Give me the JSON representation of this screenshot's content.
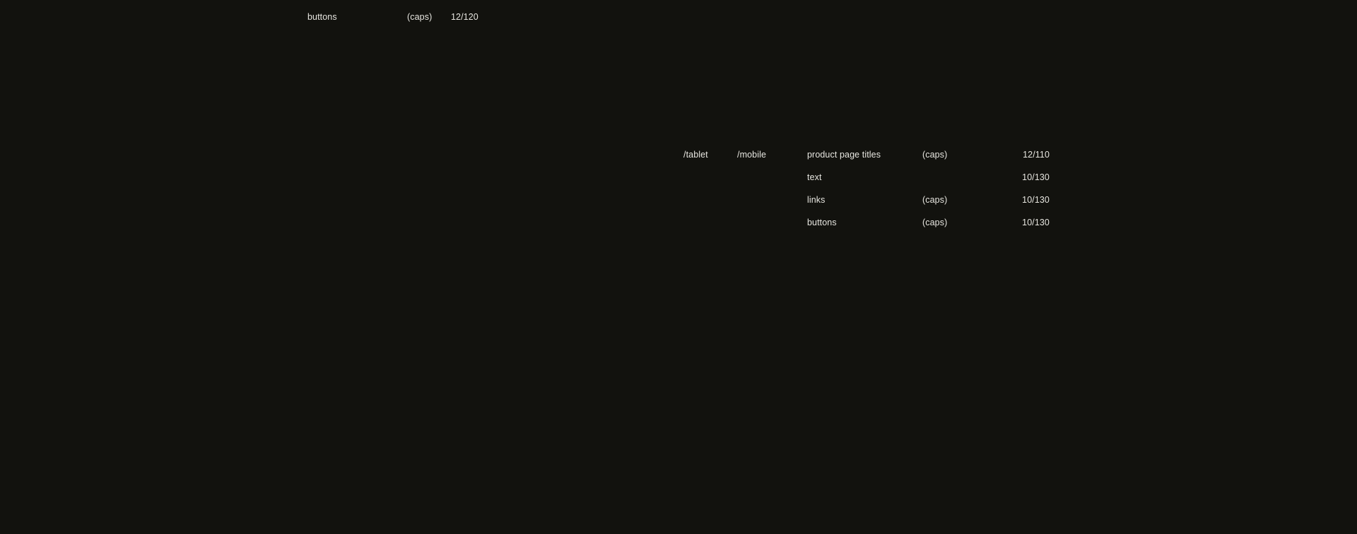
{
  "top_spec": {
    "label": "buttons",
    "modifier": "(caps)",
    "size": "12/120"
  },
  "breakpoints": {
    "tablet": "/tablet",
    "mobile": "/mobile"
  },
  "mobile_specs": [
    {
      "label": "product page titles",
      "modifier": "(caps)",
      "size": "12/110"
    },
    {
      "label": "text",
      "modifier": "",
      "size": "10/130"
    },
    {
      "label": "links",
      "modifier": "(caps)",
      "size": "10/130"
    },
    {
      "label": "buttons",
      "modifier": "(caps)",
      "size": "10/130"
    }
  ]
}
